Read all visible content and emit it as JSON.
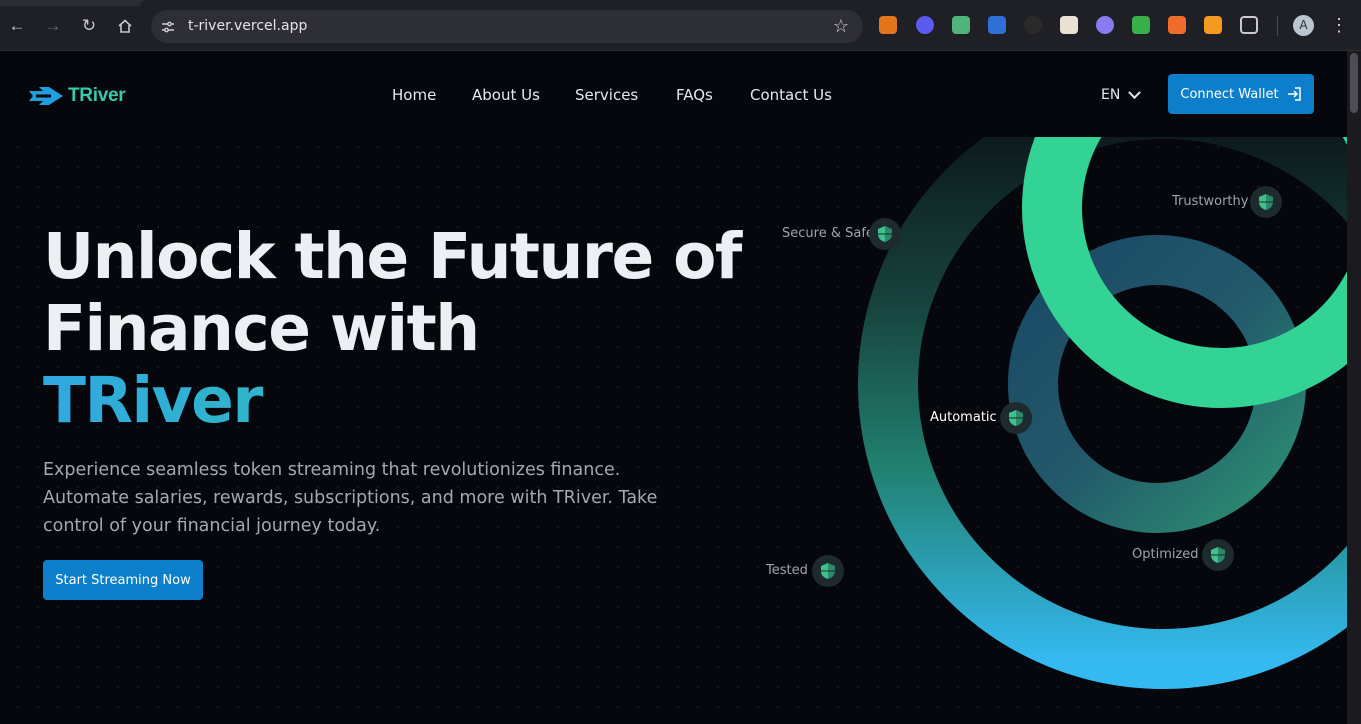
{
  "browser": {
    "url": "t-river.vercel.app",
    "profile_initial": "A",
    "extensions": [
      "metamask-icon",
      "puzzle-sun-icon",
      "rocket-icon",
      "camera-icon",
      "gnome-icon",
      "calendar-icon",
      "ghost-icon",
      "shield-check-icon",
      "arrow-icon",
      "fox-icon",
      "extensions-icon"
    ]
  },
  "nav": {
    "brand": "TRiver",
    "items": [
      "Home",
      "About Us",
      "Services",
      "FAQs",
      "Contact Us"
    ],
    "language": "EN",
    "connect_label": "Connect Wallet"
  },
  "hero": {
    "title_line1": "Unlock the Future of",
    "title_line2": "Finance with",
    "title_accent": "TRiver",
    "description": "Experience seamless token streaming that revolutionizes finance. Automate salaries, rewards, subscriptions, and more with TRiver. Take control of your financial journey today.",
    "cta_label": "Start Streaming Now"
  },
  "features": [
    "Secure & Safe",
    "Trustworthy",
    "Automatic",
    "Tested",
    "Optimized"
  ],
  "colors": {
    "accent_blue": "#0d7ec9",
    "accent_teal": "#37c9a9",
    "ring_green": "#33d395",
    "ring_blue": "#34b9f0",
    "background": "#05070d"
  }
}
